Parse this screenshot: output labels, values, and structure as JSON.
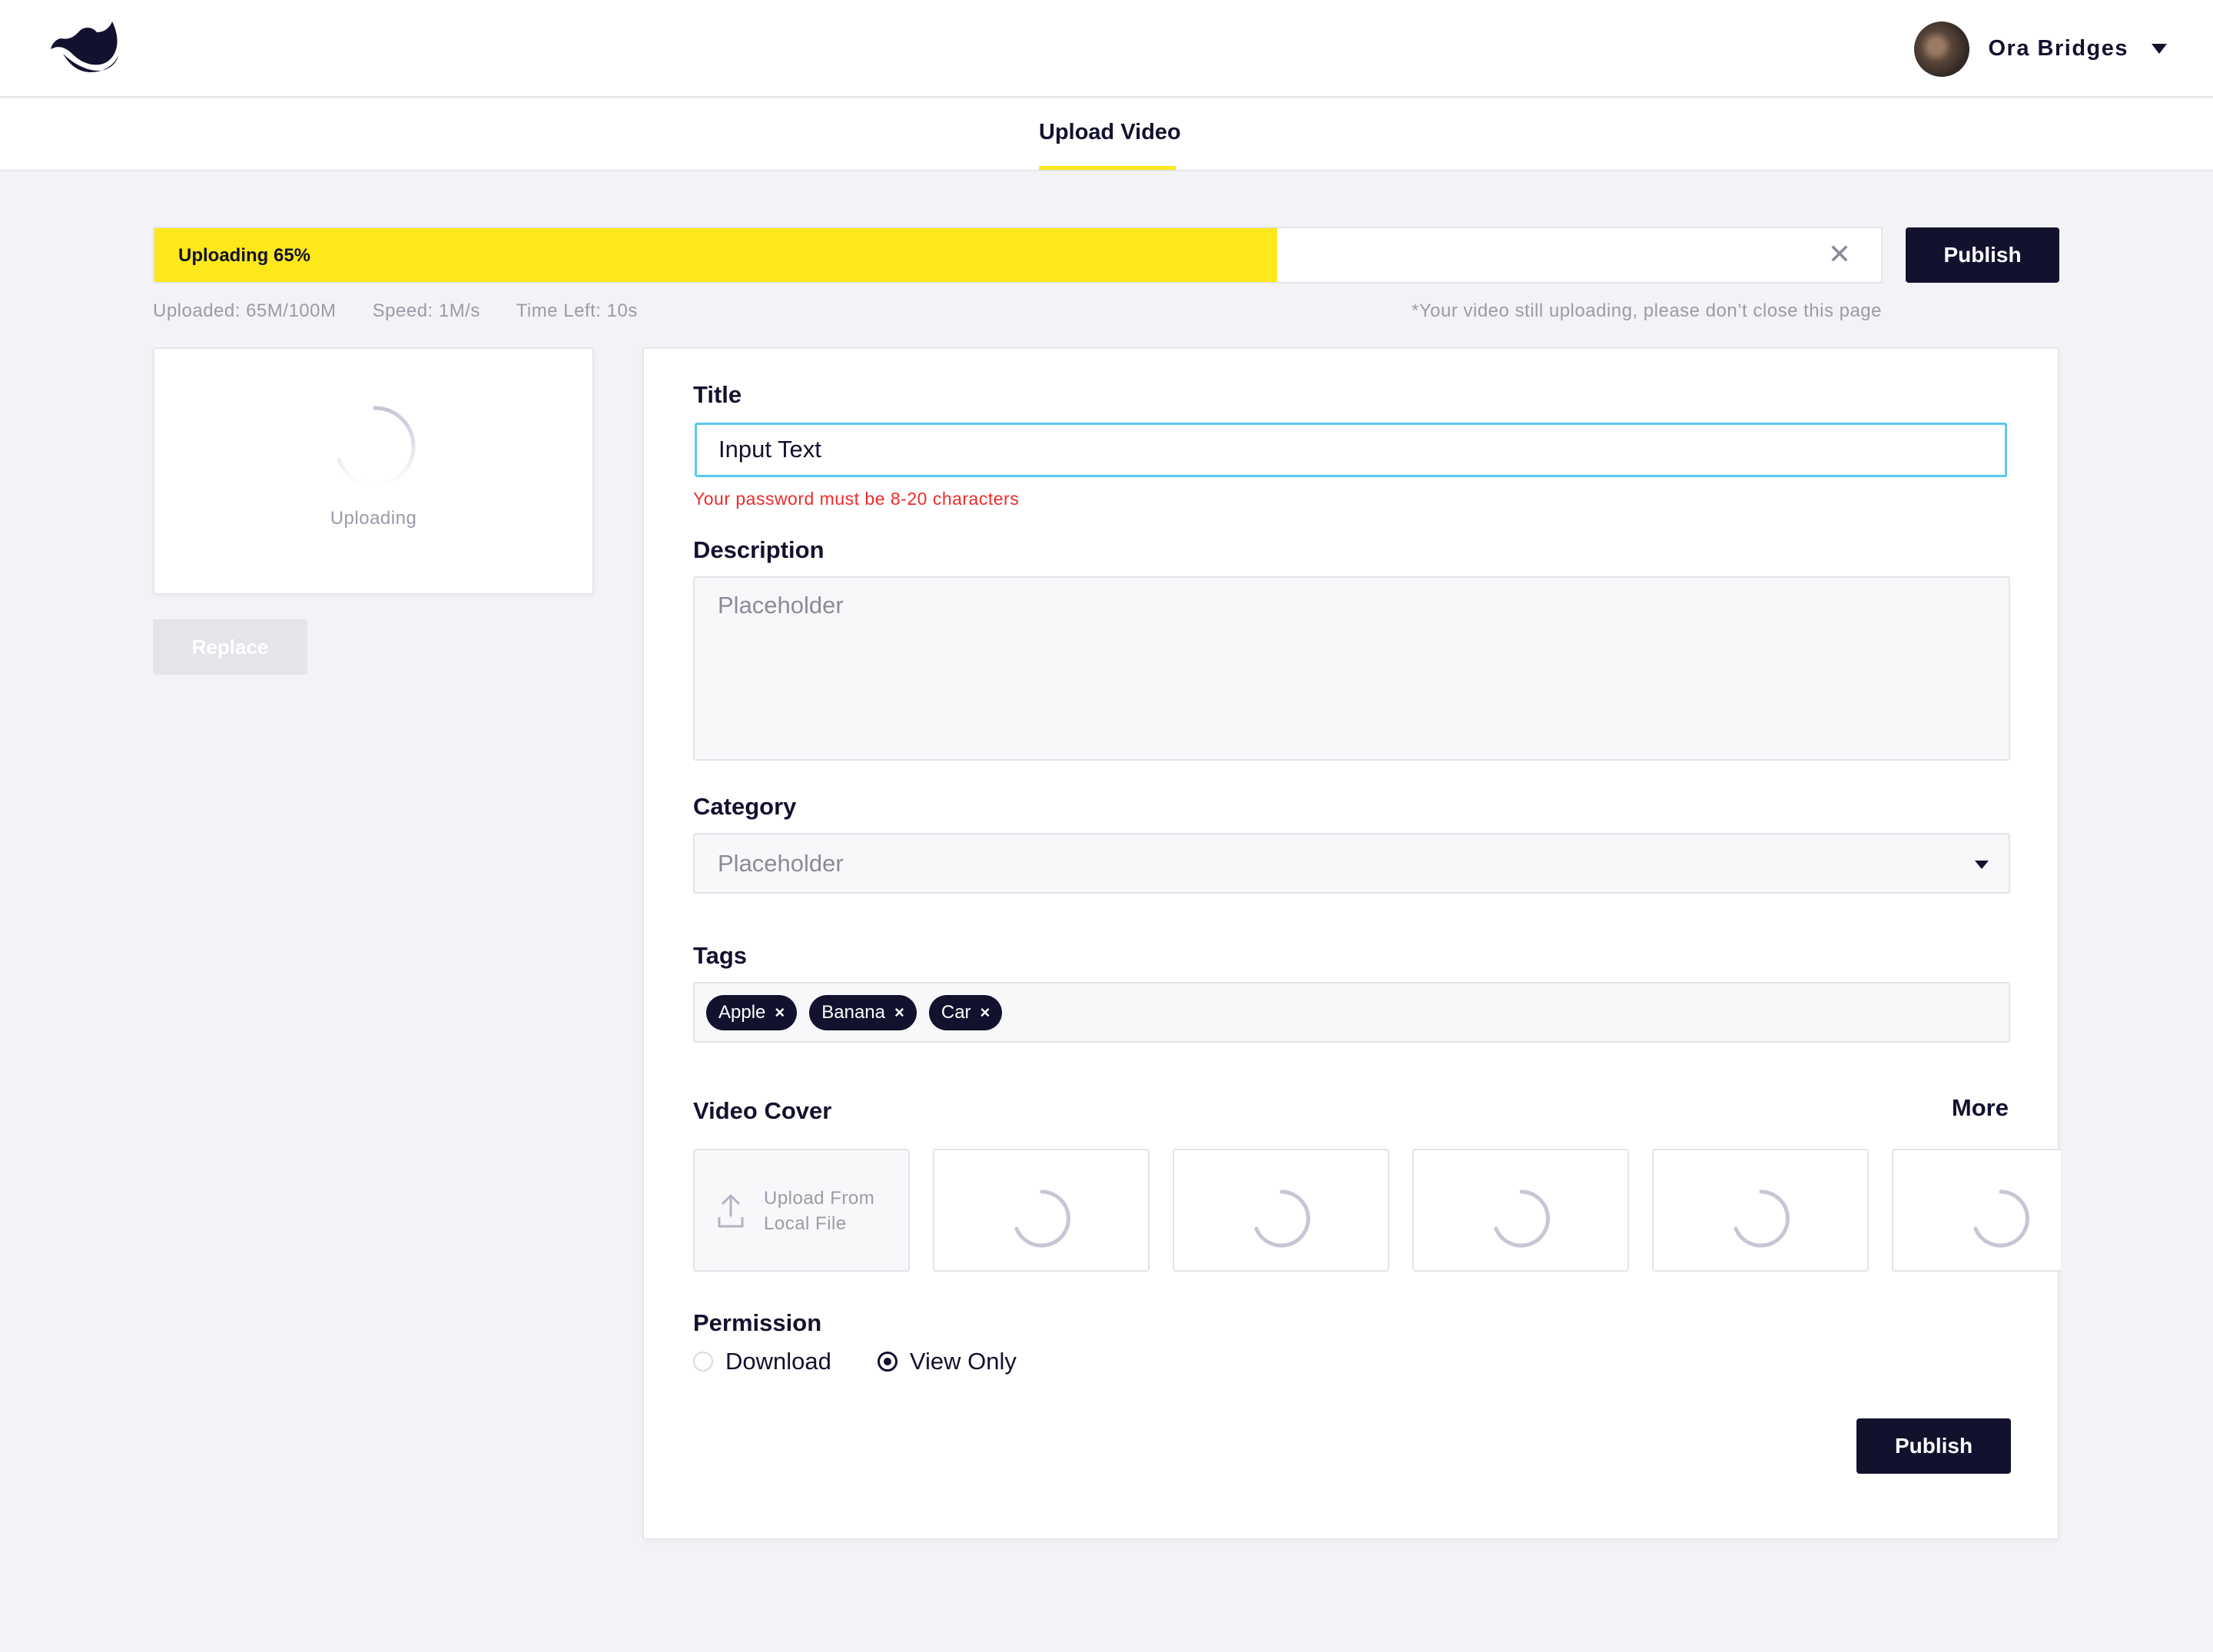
{
  "header": {
    "user_name": "Ora Bridges",
    "tab_label": "Upload Video"
  },
  "upload": {
    "progress_label": "Uploading 65%",
    "progress_fraction": 0.65,
    "close_symbol": "✕",
    "publish_label": "Publish",
    "uploaded": "Uploaded: 65M/100M",
    "speed": "Speed: 1M/s",
    "time_left": "Time Left: 10s",
    "notice": "*Your  video still uploading, please don’t close  this page"
  },
  "preview": {
    "status": "Uploading",
    "replace_label": "Replace"
  },
  "form": {
    "title_label": "Title",
    "title_value": "Input Text",
    "title_error": "Your password must be 8-20 characters",
    "description_label": "Description",
    "description_placeholder": "Placeholder",
    "category_label": "Category",
    "category_placeholder": "Placeholder",
    "tags_label": "Tags",
    "tags": [
      "Apple",
      "Banana",
      "Car"
    ],
    "tag_remove_symbol": "×",
    "cover_label": "Video Cover",
    "more_label": "More",
    "upload_cover_line1": "Upload From",
    "upload_cover_line2": "Local File",
    "permission_label": "Permission",
    "permission_options": [
      "Download",
      "View Only"
    ],
    "permission_selected": "View Only",
    "publish_label": "Publish"
  },
  "colors": {
    "accent": "#fde81a",
    "primary": "#12112e",
    "error": "#ee2b2b",
    "focus": "#5ac7f0"
  }
}
